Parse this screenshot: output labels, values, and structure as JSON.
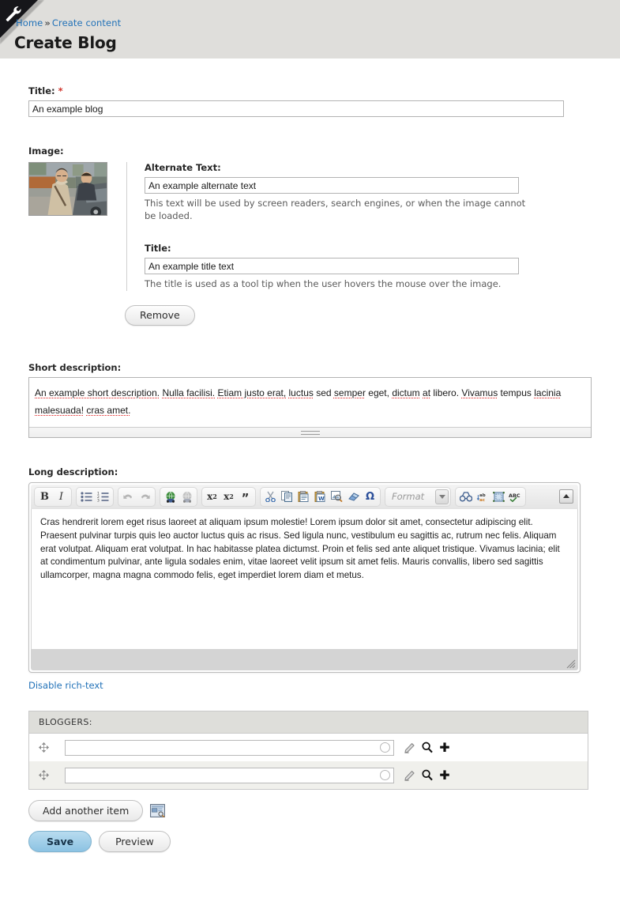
{
  "header": {
    "corner_icon": "wrench-icon",
    "breadcrumb": {
      "home": "Home",
      "separator": "»",
      "current": "Create content"
    },
    "title": "Create Blog"
  },
  "title_field": {
    "label": "Title:",
    "required_marker": "*",
    "value": "An example blog",
    "placeholder": ""
  },
  "image_field": {
    "label": "Image:",
    "thumbnail_alt": "photo of a man in a beige coat standing beside a car",
    "alt_text": {
      "label": "Alternate Text:",
      "value": "An example alternate text",
      "placeholder": "",
      "help": "This text will be used by screen readers, search engines, or when the image cannot be loaded."
    },
    "title_text": {
      "label": "Title:",
      "value": "An example title text",
      "placeholder": "",
      "help": "The title is used as a tool tip when the user hovers the mouse over the image."
    },
    "remove_label": "Remove"
  },
  "short_description": {
    "label": "Short description:",
    "value_part1": "An example short description.",
    "value": "An example short description. Nulla facilisi. Etiam justo erat, luctus sed semper eget, dictum at libero. Vivamus tempus lacinia malesuada! cras amet.",
    "spellchecked_words": [
      "An example short description.",
      "Nulla facilisi.",
      "Etiam justo erat,",
      "luctus",
      "semper",
      "dictum",
      "at",
      "Vivamus",
      "lacinia malesuada!",
      "cras amet."
    ]
  },
  "long_description": {
    "label": "Long description:",
    "toolbar": {
      "groups": [
        {
          "name": "basicstyles",
          "buttons": [
            "bold-icon",
            "italic-icon"
          ]
        },
        {
          "name": "lists",
          "buttons": [
            "bulleted-list-icon",
            "numbered-list-icon"
          ]
        },
        {
          "name": "undo",
          "buttons": [
            "undo-icon",
            "redo-icon"
          ]
        },
        {
          "name": "links",
          "buttons": [
            "link-icon",
            "unlink-icon"
          ]
        },
        {
          "name": "scripts",
          "buttons": [
            "superscript-icon",
            "subscript-icon",
            "blockquote-icon"
          ]
        },
        {
          "name": "clipboard",
          "buttons": [
            "cut-icon",
            "copy-icon",
            "paste-icon",
            "paste-from-word-icon",
            "image-icon",
            "remove-format-icon",
            "special-character-icon"
          ]
        },
        {
          "name": "tools",
          "buttons": [
            "find-icon",
            "replace-icon",
            "maximize-icon",
            "spellcheck-icon"
          ]
        }
      ],
      "bold_label": "B",
      "italic_label": "I",
      "superscript_label": "x",
      "superscript_exp": "2",
      "subscript_label": "x",
      "subscript_exp": "2",
      "blockquote_label": "”",
      "omega_label": "Ω",
      "spellcheck_label": "ABC",
      "format_placeholder": "Format",
      "collapse_icon": "collapse-toolbar-icon"
    },
    "body_text": "Cras hendrerit lorem eget risus laoreet at aliquam ipsum molestie! Lorem ipsum dolor sit amet, consectetur adipiscing elit. Praesent pulvinar turpis quis leo auctor luctus quis ac risus. Sed ligula nunc, vestibulum eu sagittis ac, rutrum nec felis. Aliquam erat volutpat. Aliquam erat volutpat. In hac habitasse platea dictumst. Proin et felis sed ante aliquet tristique. Vivamus lacinia; elit at condimentum pulvinar, ante ligula sodales enim, vitae laoreet velit ipsum sit amet felis. Mauris convallis, libero sed sagittis ullamcorper, magna magna commodo felis, eget imperdiet lorem diam et metus.",
    "disable_link": "Disable rich-text"
  },
  "bloggers": {
    "header": "BLOGGERS:",
    "rows": [
      {
        "value": "",
        "placeholder": "",
        "icons": [
          "drag-handle-icon",
          "throbber-icon",
          "edit-pencil-icon",
          "search-icon",
          "add-plus-icon"
        ]
      },
      {
        "value": "",
        "placeholder": "",
        "icons": [
          "drag-handle-icon",
          "throbber-icon",
          "edit-pencil-icon",
          "search-icon",
          "add-plus-icon"
        ]
      }
    ],
    "add_another_label": "Add another item",
    "add_another_icon": "form-window-icon"
  },
  "actions": {
    "save_label": "Save",
    "preview_label": "Preview"
  },
  "colors": {
    "header_bg": "#dfdedb",
    "link": "#2272b8",
    "required": "#d0342c",
    "save_bg": "#8cc3e3",
    "spellcheck_underline": "#e01b1b",
    "table_header_bg": "#dededa",
    "row_alt_bg": "#f0f0ec"
  }
}
